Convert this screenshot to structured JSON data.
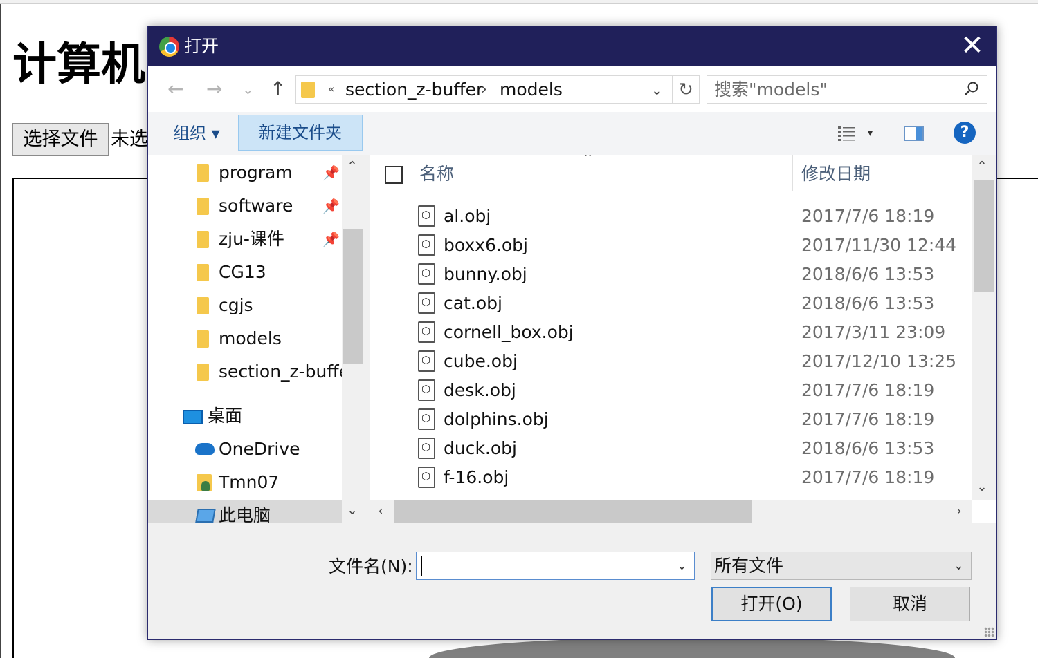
{
  "page": {
    "heading": "计算机",
    "file_button": "选择文件",
    "no_file_text": "未选"
  },
  "dialog": {
    "title": "打开",
    "close_symbol": "✕",
    "nav": {
      "back": "←",
      "forward": "→",
      "recent": "⌄",
      "up": "↑",
      "address_overflow": "«",
      "address": [
        "section_z-buffer",
        "models"
      ],
      "address_separator": "›",
      "refresh": "↻",
      "search_placeholder": "搜索\"models\""
    },
    "toolbar": {
      "organize": "组织 ▾",
      "new_folder": "新建文件夹",
      "help": "?"
    },
    "sidebar": {
      "pin": "📌",
      "items": [
        {
          "label": "program",
          "pinned": true
        },
        {
          "label": "software",
          "pinned": true
        },
        {
          "label": "zju-课件",
          "pinned": true
        },
        {
          "label": "CG13",
          "pinned": false
        },
        {
          "label": "cgjs",
          "pinned": false
        },
        {
          "label": "models",
          "pinned": false
        },
        {
          "label": "section_z-buffe",
          "pinned": false
        }
      ],
      "locations": [
        "桌面",
        "OneDrive",
        "Tmn07",
        "此电脑"
      ]
    },
    "columns": {
      "name": "名称",
      "modified": "修改日期",
      "sort_caret": "^"
    },
    "files": [
      {
        "name": "al.obj",
        "date": "2017/7/6 18:19"
      },
      {
        "name": "boxx6.obj",
        "date": "2017/11/30 12:44"
      },
      {
        "name": "bunny.obj",
        "date": "2018/6/6 13:53"
      },
      {
        "name": "cat.obj",
        "date": "2018/6/6 13:53"
      },
      {
        "name": "cornell_box.obj",
        "date": "2017/3/11 23:09"
      },
      {
        "name": "cube.obj",
        "date": "2017/12/10 13:25"
      },
      {
        "name": "desk.obj",
        "date": "2017/7/6 18:19"
      },
      {
        "name": "dolphins.obj",
        "date": "2017/7/6 18:19"
      },
      {
        "name": "duck.obj",
        "date": "2018/6/6 13:53"
      },
      {
        "name": "f-16.obj",
        "date": "2017/7/6 18:19"
      }
    ],
    "footer": {
      "filename_label": "文件名(N):",
      "filename_value": "",
      "filetype": "所有文件",
      "open_button": "打开(O)",
      "cancel_button": "取消"
    }
  }
}
